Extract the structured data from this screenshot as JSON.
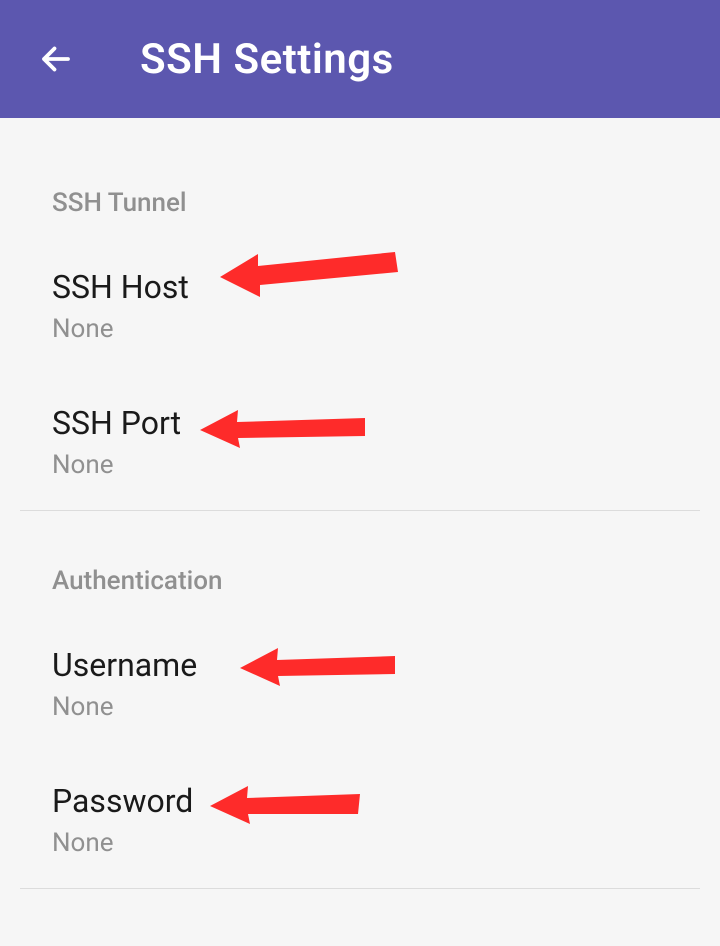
{
  "header": {
    "title": "SSH Settings"
  },
  "sections": {
    "tunnel": {
      "header": "SSH Tunnel",
      "host": {
        "label": "SSH Host",
        "value": "None"
      },
      "port": {
        "label": "SSH Port",
        "value": "None"
      }
    },
    "auth": {
      "header": "Authentication",
      "username": {
        "label": "Username",
        "value": "None"
      },
      "password": {
        "label": "Password",
        "value": "None"
      }
    }
  },
  "annotations": {
    "arrow_color": "#fe2b2a"
  }
}
